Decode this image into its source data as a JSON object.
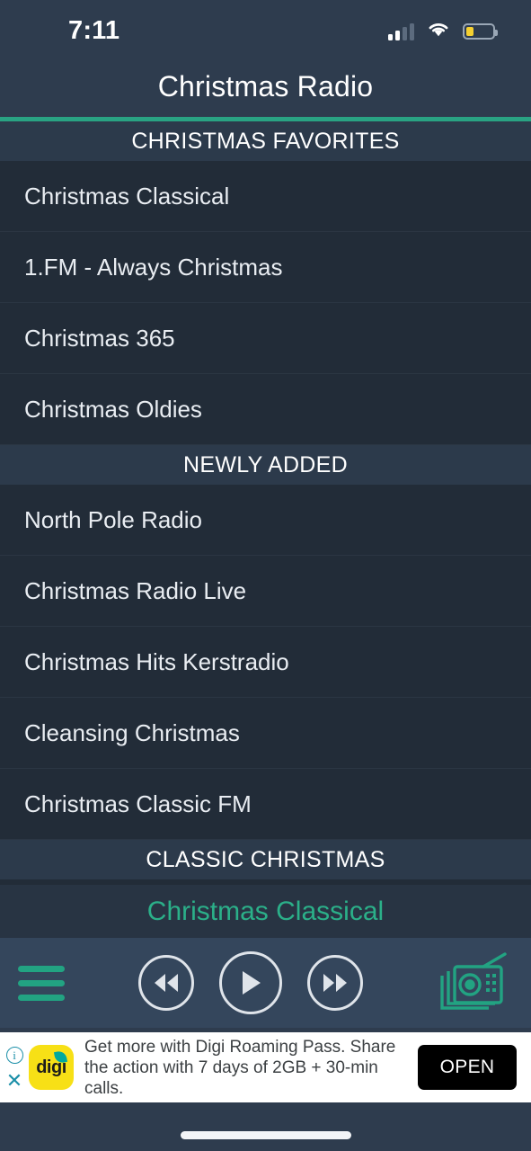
{
  "status_bar": {
    "time": "7:11",
    "cellular_icon": "cellular-bars-icon",
    "cellular_bars_filled": 2,
    "cellular_bars_total": 4,
    "wifi_icon": "wifi-icon",
    "battery_icon": "battery-low-icon",
    "battery_level_percent": 28,
    "battery_color": "#f5d030"
  },
  "header": {
    "title": "Christmas Radio",
    "accent_color": "#29a383"
  },
  "sections": [
    {
      "title": "CHRISTMAS FAVORITES",
      "items": [
        {
          "label": "Christmas Classical"
        },
        {
          "label": "1.FM - Always Christmas"
        },
        {
          "label": "Christmas 365"
        },
        {
          "label": "Christmas Oldies"
        }
      ]
    },
    {
      "title": "NEWLY ADDED",
      "items": [
        {
          "label": "North Pole Radio"
        },
        {
          "label": "Christmas Radio Live"
        },
        {
          "label": "Christmas Hits Kerstradio"
        },
        {
          "label": "Cleansing Christmas"
        },
        {
          "label": "Christmas Classic FM"
        }
      ]
    },
    {
      "title": "CLASSIC CHRISTMAS",
      "items": [
        {
          "label": ""
        }
      ]
    }
  ],
  "now_playing": {
    "station": "Christmas Classical",
    "color": "#2bb089"
  },
  "transport": {
    "menu_icon": "hamburger-menu-icon",
    "rewind_icon": "rewind-icon",
    "play_icon": "play-icon",
    "forward_icon": "fast-forward-icon",
    "stations_icon": "radio-stack-icon",
    "accent_color": "#22a382"
  },
  "ad": {
    "info_icon": "info-icon",
    "close_icon": "close-icon",
    "advertiser": "digi",
    "text": "Get more with Digi Roaming Pass. Share the action with 7 days of 2GB + 30-min calls.",
    "cta_label": "OPEN",
    "logo_background": "#f7e016"
  },
  "home_indicator": "home-indicator"
}
